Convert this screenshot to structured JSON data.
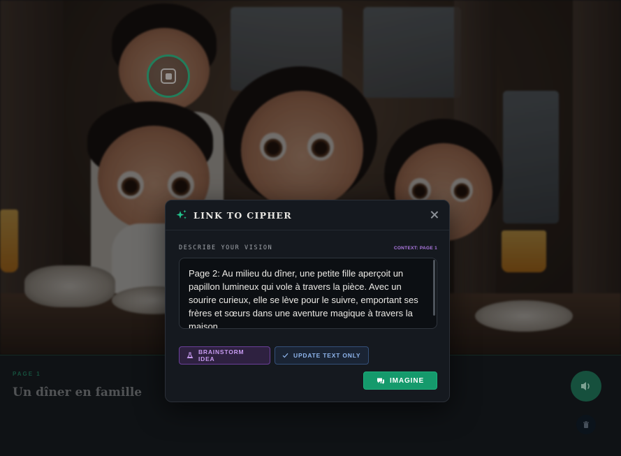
{
  "modal": {
    "title": "LINK TO CIPHER",
    "field_label": "DESCRIBE YOUR VISION",
    "context": "CONTEXT: PAGE 1",
    "vision_text": "Page 2: Au milieu du dîner, une petite fille aperçoit un papillon lumineux qui vole à travers la pièce. Avec un sourire curieux, elle se lève pour le suivre, emportant ses frères et sœurs dans une aventure magique à travers la maison.",
    "buttons": {
      "brainstorm": "BRAINSTORM IDEA",
      "update": "UPDATE TEXT ONLY",
      "imagine": "IMAGINE"
    }
  },
  "page": {
    "label": "PAGE 1",
    "title": "Un dîner en famille"
  },
  "icons": {
    "title": "sparkle-icon",
    "close": "close-icon",
    "brainstorm": "flask-icon",
    "update": "check-icon",
    "imagine": "chat-bubble-icon",
    "audio": "speaker-icon",
    "delete": "trash-icon",
    "scan": "scan-target-icon"
  },
  "colors": {
    "accent_green": "#159a6c",
    "brainstorm_purple": "#c79bf0",
    "update_blue": "#8fb6ee",
    "context_purple": "#b07ae6"
  }
}
